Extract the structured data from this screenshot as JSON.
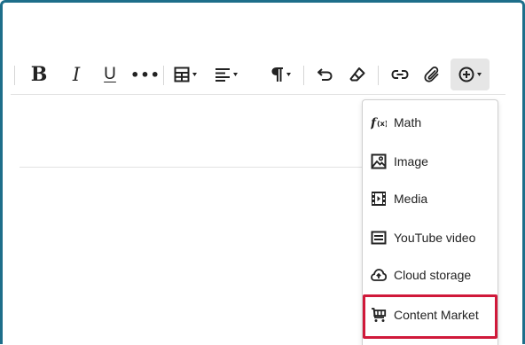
{
  "toolbar": {
    "bold_label": "B",
    "italic_label": "I",
    "underline_label": "U",
    "more_label": "•••"
  },
  "insert_menu": {
    "items": [
      {
        "label": "Math",
        "icon": "math-formula-icon"
      },
      {
        "label": "Image",
        "icon": "image-icon"
      },
      {
        "label": "Media",
        "icon": "film-icon"
      },
      {
        "label": "YouTube video",
        "icon": "youtube-icon"
      },
      {
        "label": "Cloud storage",
        "icon": "cloud-upload-icon"
      },
      {
        "label": "Content Market",
        "icon": "shopping-cart-icon"
      }
    ]
  },
  "colors": {
    "frame_border": "#1d6e8a",
    "highlight": "#d0193a",
    "active_button_bg": "#e6e6e6"
  }
}
